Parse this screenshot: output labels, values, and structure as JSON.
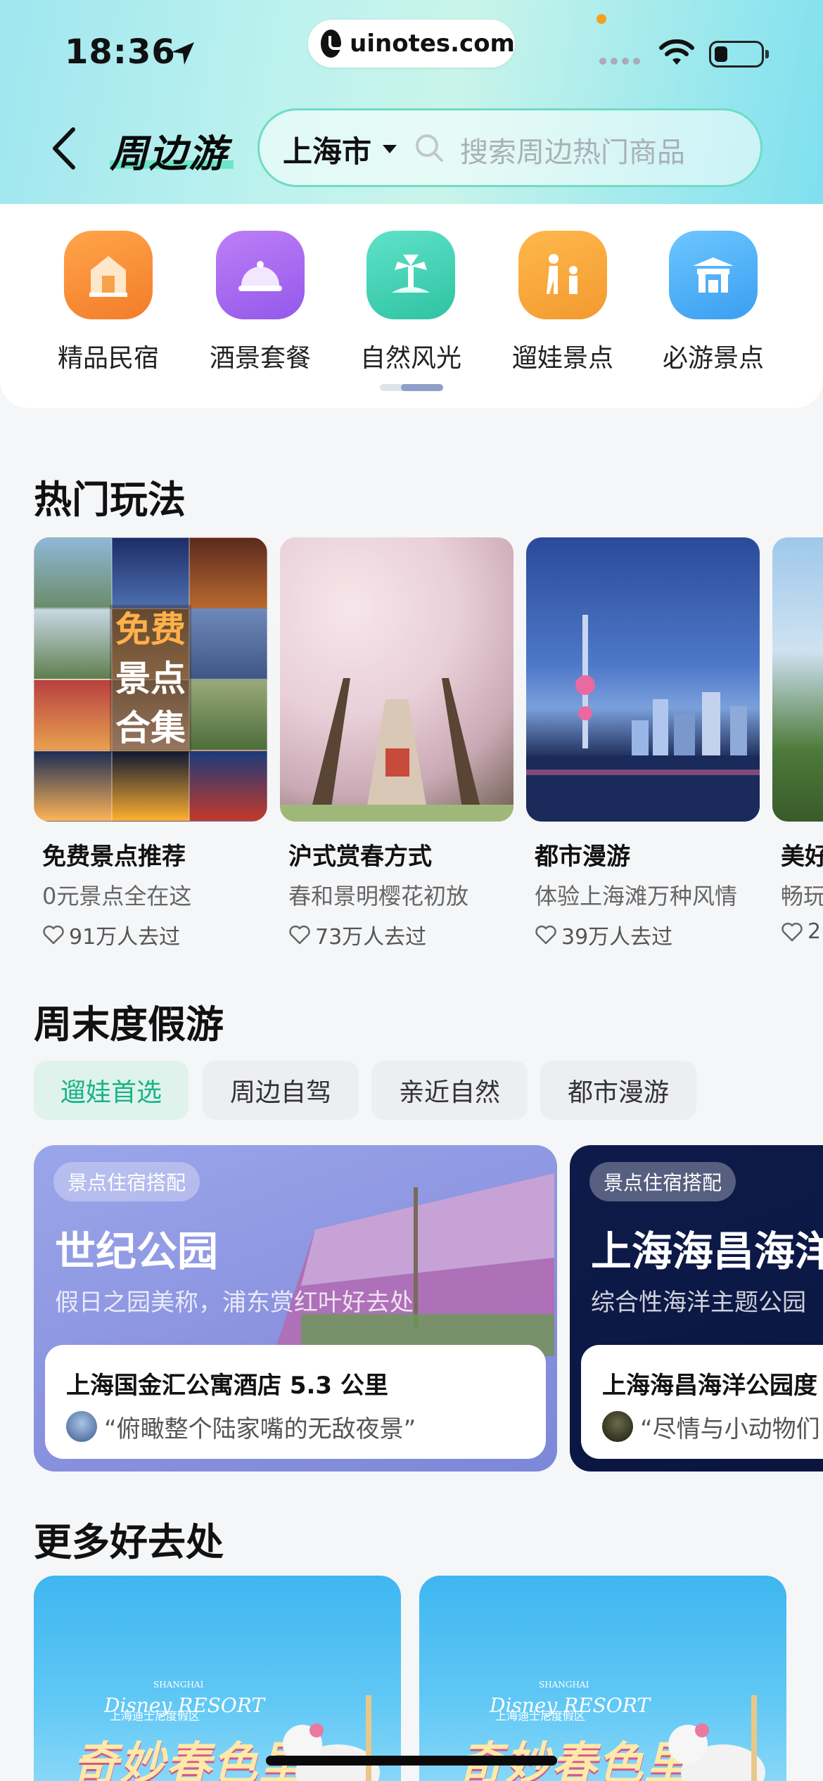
{
  "status_bar": {
    "time": "18:36",
    "url": "uinotes.com"
  },
  "header": {
    "title": "周边游",
    "city": "上海市",
    "search_placeholder": "搜索周边热门商品"
  },
  "categories": [
    {
      "label": "精品民宿",
      "icon": "homestay-icon",
      "color": "#f5923b"
    },
    {
      "label": "酒景套餐",
      "icon": "dining-bell-icon",
      "color": "#a468ee"
    },
    {
      "label": "自然风光",
      "icon": "palm-island-icon",
      "color": "#44d3b3"
    },
    {
      "label": "遛娃景点",
      "icon": "family-icon",
      "color": "#f4a63a"
    },
    {
      "label": "必游景点",
      "icon": "landmark-gate-icon",
      "color": "#4aaef2"
    }
  ],
  "hot": {
    "section_title": "热门玩法",
    "collage_text": [
      "免费",
      "景点",
      "合集"
    ],
    "cards": [
      {
        "title": "免费景点推荐",
        "subtitle": "0元景点全在这",
        "count": "91万人去过"
      },
      {
        "title": "沪式赏春方式",
        "subtitle": "春和景明樱花初放",
        "count": "73万人去过"
      },
      {
        "title": "都市漫游",
        "subtitle": "体验上海滩万种风情",
        "count": "39万人去过"
      },
      {
        "title": "美好",
        "subtitle": "畅玩",
        "count": "2"
      }
    ]
  },
  "weekend": {
    "section_title": "周末度假游",
    "tabs": [
      "遛娃首选",
      "周边自驾",
      "亲近自然",
      "都市漫游"
    ],
    "cards": [
      {
        "badge": "景点住宿搭配",
        "title": "世纪公园",
        "subtitle": "假日之园美称，浦东赏红叶好去处",
        "hotel": "上海国金汇公寓酒店   5.3 公里",
        "quote": "“俯瞰整个陆家嘴的无敌夜景”"
      },
      {
        "badge": "景点住宿搭配",
        "title": "上海海昌海洋",
        "subtitle": "综合性海洋主题公园",
        "hotel": "上海海昌海洋公园度",
        "quote": "“尽情与小动物们"
      }
    ]
  },
  "more": {
    "section_title": "更多好去处",
    "cards": [
      {
        "logo": "Disney RESORT",
        "logo_top": "SHANGHAI",
        "logo_sub": "上海迪士尼度假区",
        "slogan": "奇妙春色里"
      },
      {
        "logo": "Disney RESORT",
        "logo_top": "SHANGHAI",
        "logo_sub": "上海迪士尼度假区",
        "slogan": "奇妙春色里"
      }
    ]
  }
}
